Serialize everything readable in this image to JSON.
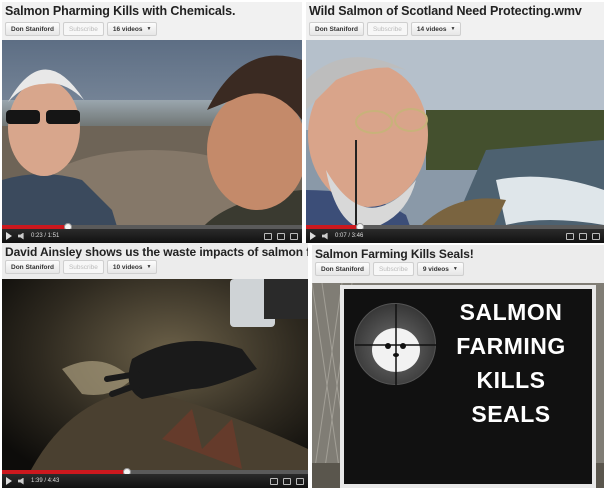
{
  "panels": [
    {
      "title": "Salmon Pharming Kills with Chemicals.",
      "uploader": "Don Staniford",
      "subscribe": "Subscribe",
      "videos": "16 videos",
      "time": "0:23 / 1:51",
      "progress": 0.22
    },
    {
      "title": "Wild Salmon of Scotland Need Protecting.wmv",
      "uploader": "Don Staniford",
      "subscribe": "Subscribe",
      "videos": "14 videos",
      "time": "0:07 / 3:46",
      "progress": 0.18
    },
    {
      "title": "David Ainsley shows us the waste impacts of salmon farms",
      "uploader": "Don Staniford",
      "subscribe": "Subscribe",
      "videos": "10 videos",
      "time": "1:39 / 4:43",
      "progress": 0.41
    },
    {
      "title": "Salmon Farming Kills Seals!",
      "uploader": "Don Staniford",
      "subscribe": "Subscribe",
      "videos": "9 videos",
      "sign_lines": [
        "SALMON",
        "FARMING",
        "KILLS",
        "SEALS"
      ]
    }
  ],
  "colors": {
    "progress_fill": "#cc181e",
    "title_text": "#222222"
  },
  "icons": [
    "play-icon",
    "volume-icon",
    "settings-icon",
    "fullscreen-icon",
    "crosshair-icon"
  ]
}
